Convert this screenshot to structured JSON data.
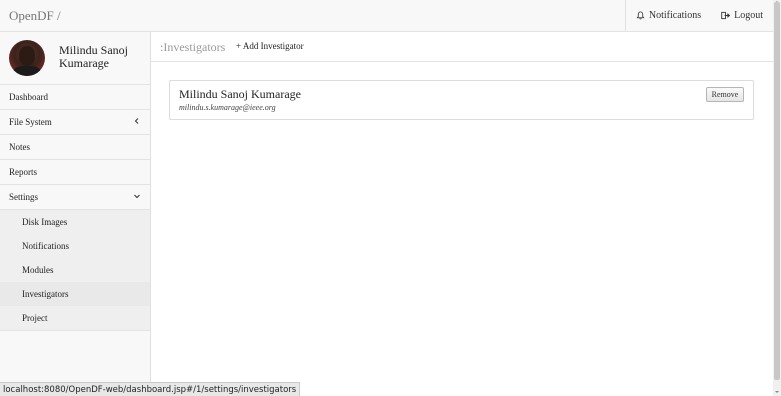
{
  "navbar": {
    "brand": "OpenDF /",
    "notifications_label": "Notifications",
    "logout_label": "Logout"
  },
  "profile": {
    "name": "Milindu Sanoj Kumarage"
  },
  "sidebar": {
    "items": [
      {
        "label": "Dashboard"
      },
      {
        "label": "File System"
      },
      {
        "label": "Notes"
      },
      {
        "label": "Reports"
      },
      {
        "label": "Settings"
      }
    ],
    "settings_items": [
      {
        "label": "Disk Images"
      },
      {
        "label": "Notifications"
      },
      {
        "label": "Modules"
      },
      {
        "label": "Investigators"
      },
      {
        "label": "Project"
      }
    ]
  },
  "content": {
    "section_title": ":Investigators",
    "add_link": "+ Add Investigator",
    "investigator": {
      "name": "Milindu Sanoj Kumarage",
      "email": "milindu.s.kumarage@ieee.org",
      "remove_label": "Remove"
    }
  },
  "statusbar": {
    "url": "localhost:8080/OpenDF-web/dashboard.jsp#/1/settings/investigators"
  },
  "icons": {
    "bell": "bell-icon",
    "logout": "logout-icon",
    "chevron_left": "chevron-left-icon",
    "chevron_down": "chevron-down-icon"
  }
}
